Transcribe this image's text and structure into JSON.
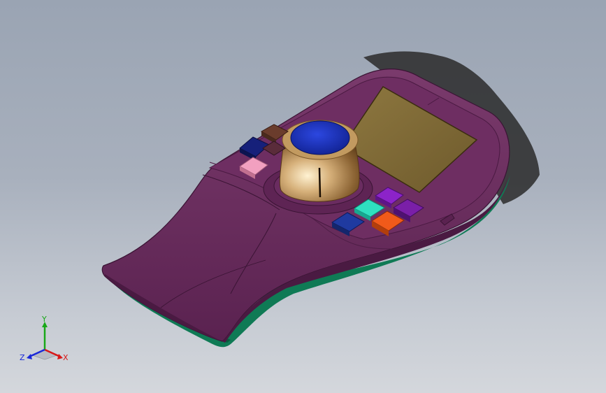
{
  "viewport": {
    "background_top": "#9aa4b3",
    "background_bottom": "#d4d7dc"
  },
  "model": {
    "body_color": "#6b2b5e",
    "base_color": "#0f7a55",
    "screen_color": "#7f6a35",
    "knob_color": "#c8a36a",
    "knob_cap_color": "#1a2fb0"
  },
  "keys": [
    {
      "name": "navy-key-left",
      "color": "#16207a"
    },
    {
      "name": "brown-key-top",
      "color": "#6a3c2c"
    },
    {
      "name": "brown-key-small",
      "color": "#5a2c3a"
    },
    {
      "name": "pink-key",
      "color": "#f2a0c0"
    },
    {
      "name": "purple-key-top",
      "color": "#8c23c9"
    },
    {
      "name": "cyan-key",
      "color": "#2fe0c0"
    },
    {
      "name": "purple-key-right",
      "color": "#7a1fa8"
    },
    {
      "name": "navy-key-right",
      "color": "#1f3aa0"
    },
    {
      "name": "orange-key",
      "color": "#f05a1a"
    }
  ],
  "triad": {
    "y_label": "Y",
    "x_label": "X",
    "z_label": "Z",
    "y_color": "#18a818",
    "x_color": "#d81818",
    "z_color": "#1a28d8"
  }
}
